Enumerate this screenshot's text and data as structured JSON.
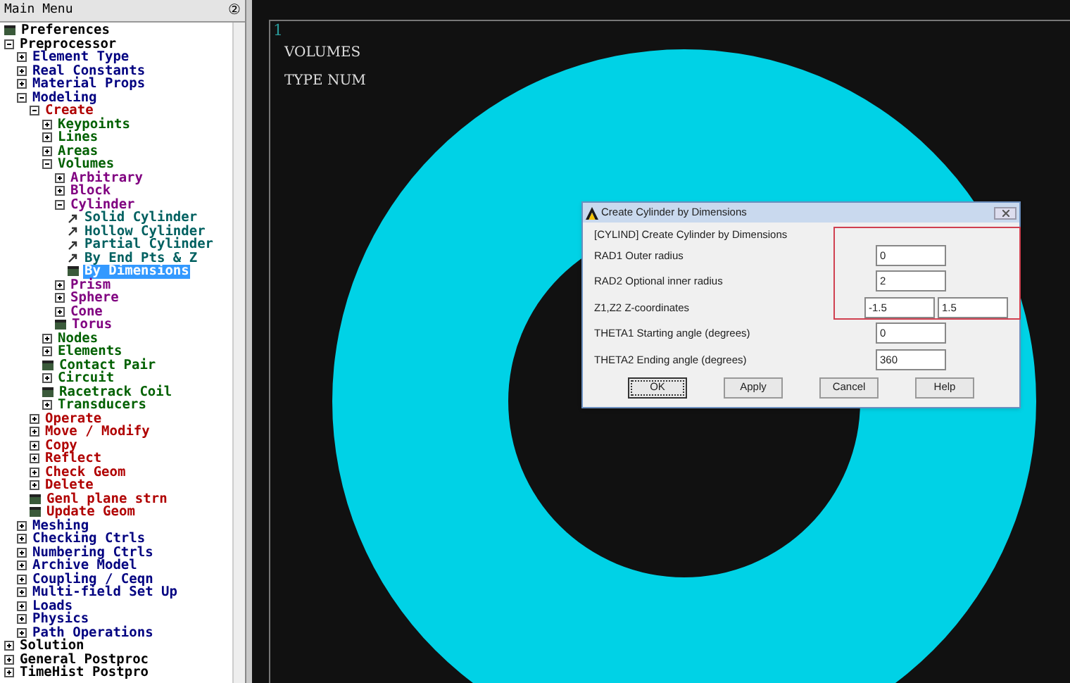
{
  "main_menu": {
    "title": "Main Menu",
    "help_glyph": "②",
    "items": [
      {
        "label": "Preferences",
        "kind": "dialog",
        "color": "#000000"
      },
      {
        "label": "Preprocessor",
        "kind": "folder",
        "expanded": true,
        "color": "#000000",
        "children": [
          {
            "label": "Element Type",
            "kind": "folder",
            "expanded": false,
            "color": "#000080"
          },
          {
            "label": "Real Constants",
            "kind": "folder",
            "expanded": false,
            "color": "#000080"
          },
          {
            "label": "Material Props",
            "kind": "folder",
            "expanded": false,
            "color": "#000080"
          },
          {
            "label": "Modeling",
            "kind": "folder",
            "expanded": true,
            "color": "#000080",
            "children": [
              {
                "label": "Create",
                "kind": "folder",
                "expanded": true,
                "color": "#b00000",
                "children": [
                  {
                    "label": "Keypoints",
                    "kind": "folder",
                    "expanded": false,
                    "color": "#006000"
                  },
                  {
                    "label": "Lines",
                    "kind": "folder",
                    "expanded": false,
                    "color": "#006000"
                  },
                  {
                    "label": "Areas",
                    "kind": "folder",
                    "expanded": false,
                    "color": "#006000"
                  },
                  {
                    "label": "Volumes",
                    "kind": "folder",
                    "expanded": true,
                    "color": "#006000",
                    "children": [
                      {
                        "label": "Arbitrary",
                        "kind": "folder",
                        "expanded": false,
                        "color": "#800080"
                      },
                      {
                        "label": "Block",
                        "kind": "folder",
                        "expanded": false,
                        "color": "#800080"
                      },
                      {
                        "label": "Cylinder",
                        "kind": "folder",
                        "expanded": true,
                        "color": "#800080",
                        "children": [
                          {
                            "label": "Solid Cylinder",
                            "kind": "action",
                            "color": "#006060"
                          },
                          {
                            "label": "Hollow Cylinder",
                            "kind": "action",
                            "color": "#006060"
                          },
                          {
                            "label": "Partial Cylinder",
                            "kind": "action",
                            "color": "#006060"
                          },
                          {
                            "label": "By End Pts & Z",
                            "kind": "action",
                            "color": "#006060"
                          },
                          {
                            "label": "By Dimensions",
                            "kind": "dialog",
                            "selected": true
                          }
                        ]
                      },
                      {
                        "label": "Prism",
                        "kind": "folder",
                        "expanded": false,
                        "color": "#800080"
                      },
                      {
                        "label": "Sphere",
                        "kind": "folder",
                        "expanded": false,
                        "color": "#800080"
                      },
                      {
                        "label": "Cone",
                        "kind": "folder",
                        "expanded": false,
                        "color": "#800080"
                      },
                      {
                        "label": "Torus",
                        "kind": "dialog",
                        "color": "#800080"
                      }
                    ]
                  },
                  {
                    "label": "Nodes",
                    "kind": "folder",
                    "expanded": false,
                    "color": "#006000"
                  },
                  {
                    "label": "Elements",
                    "kind": "folder",
                    "expanded": false,
                    "color": "#006000"
                  },
                  {
                    "label": "Contact Pair",
                    "kind": "dialog",
                    "color": "#006000"
                  },
                  {
                    "label": "Circuit",
                    "kind": "folder",
                    "expanded": false,
                    "color": "#006000"
                  },
                  {
                    "label": "Racetrack Coil",
                    "kind": "dialog",
                    "color": "#006000"
                  },
                  {
                    "label": "Transducers",
                    "kind": "folder",
                    "expanded": false,
                    "color": "#006000"
                  }
                ]
              },
              {
                "label": "Operate",
                "kind": "folder",
                "expanded": false,
                "color": "#b00000"
              },
              {
                "label": "Move / Modify",
                "kind": "folder",
                "expanded": false,
                "color": "#b00000"
              },
              {
                "label": "Copy",
                "kind": "folder",
                "expanded": false,
                "color": "#b00000"
              },
              {
                "label": "Reflect",
                "kind": "folder",
                "expanded": false,
                "color": "#b00000"
              },
              {
                "label": "Check Geom",
                "kind": "folder",
                "expanded": false,
                "color": "#b00000"
              },
              {
                "label": "Delete",
                "kind": "folder",
                "expanded": false,
                "color": "#b00000"
              },
              {
                "label": "Genl plane strn",
                "kind": "dialog",
                "color": "#b00000"
              },
              {
                "label": "Update Geom",
                "kind": "dialog",
                "color": "#b00000"
              }
            ]
          },
          {
            "label": "Meshing",
            "kind": "folder",
            "expanded": false,
            "color": "#000080"
          },
          {
            "label": "Checking Ctrls",
            "kind": "folder",
            "expanded": false,
            "color": "#000080"
          },
          {
            "label": "Numbering Ctrls",
            "kind": "folder",
            "expanded": false,
            "color": "#000080"
          },
          {
            "label": "Archive Model",
            "kind": "folder",
            "expanded": false,
            "color": "#000080"
          },
          {
            "label": "Coupling / Ceqn",
            "kind": "folder",
            "expanded": false,
            "color": "#000080"
          },
          {
            "label": "Multi-field Set Up",
            "kind": "folder",
            "expanded": false,
            "color": "#000080"
          },
          {
            "label": "Loads",
            "kind": "folder",
            "expanded": false,
            "color": "#000080"
          },
          {
            "label": "Physics",
            "kind": "folder",
            "expanded": false,
            "color": "#000080"
          },
          {
            "label": "Path Operations",
            "kind": "folder",
            "expanded": false,
            "color": "#000080"
          }
        ]
      },
      {
        "label": "Solution",
        "kind": "folder",
        "expanded": false,
        "color": "#000000"
      },
      {
        "label": "General Postproc",
        "kind": "folder",
        "expanded": false,
        "color": "#000000"
      },
      {
        "label": "TimeHist Postpro",
        "kind": "folder",
        "expanded": false,
        "color": "#000000"
      }
    ]
  },
  "graphics": {
    "window_number": "1",
    "legend": [
      "VOLUMES",
      "TYPE NUM"
    ]
  },
  "dialog": {
    "title": "Create Cylinder by Dimensions",
    "command": "[CYLIND]  Create Cylinder by Dimensions",
    "highlight_box": true,
    "rows": [
      {
        "code": "RAD1",
        "label": "Outer radius",
        "values": [
          "0"
        ]
      },
      {
        "code": "RAD2",
        "label": "Optional inner radius",
        "values": [
          "2"
        ]
      },
      {
        "code": "Z1,Z2",
        "label": "Z-coordinates",
        "values": [
          "-1.5",
          "1.5"
        ]
      },
      {
        "code": "THETA1",
        "label": "Starting angle (degrees)",
        "values": [
          "0"
        ]
      },
      {
        "code": "THETA2",
        "label": "Ending angle (degrees)",
        "values": [
          "360"
        ]
      }
    ],
    "buttons": [
      {
        "label": "OK",
        "focused": true
      },
      {
        "label": "Apply",
        "focused": false
      },
      {
        "label": "Cancel",
        "focused": false
      },
      {
        "label": "Help",
        "focused": false
      }
    ]
  }
}
